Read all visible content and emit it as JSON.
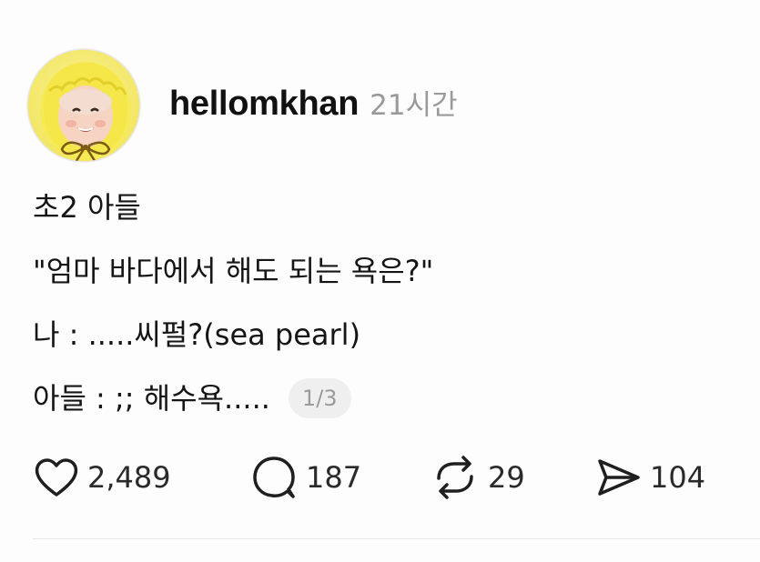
{
  "post": {
    "username": "hellomkhan",
    "timestamp": "21시간",
    "lines": [
      "초2 아들",
      "\"엄마 바다에서 해도 되는 욕은?\"",
      "나 : .....씨펄?(sea pearl)",
      "아들 : ;; 해수욕....."
    ],
    "page_indicator": "1/3"
  },
  "actions": {
    "like": {
      "icon": "heart-icon",
      "count": "2,489"
    },
    "comment": {
      "icon": "comment-bubble-icon",
      "count": "187"
    },
    "repost": {
      "icon": "repost-arrows-icon",
      "count": "29"
    },
    "share": {
      "icon": "send-paper-plane-icon",
      "count": "104"
    }
  },
  "colors": {
    "avatar_bg": "#f6ec6e",
    "timestamp": "#9a9a9a",
    "page_indicator_bg": "#efefef"
  }
}
